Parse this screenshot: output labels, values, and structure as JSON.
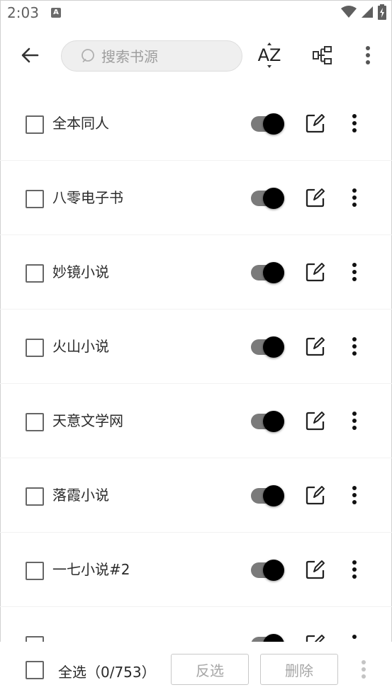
{
  "status_bar": {
    "time": "2:03",
    "notification_badge": "A"
  },
  "toolbar": {
    "back_icon": "arrow-left-icon",
    "search_placeholder": "搜索书源",
    "sort_label": "AZ",
    "group_icon": "group-tree-icon",
    "more_icon": "more-vert-icon"
  },
  "sources": [
    {
      "name": "全本同人",
      "checked": false,
      "enabled": true
    },
    {
      "name": "八零电子书",
      "checked": false,
      "enabled": true
    },
    {
      "name": "妙镜小说",
      "checked": false,
      "enabled": true
    },
    {
      "name": "火山小说",
      "checked": false,
      "enabled": true
    },
    {
      "name": "天意文学网",
      "checked": false,
      "enabled": true
    },
    {
      "name": "落霞小说",
      "checked": false,
      "enabled": true
    },
    {
      "name": "一七小说#2",
      "checked": false,
      "enabled": true
    },
    {
      "name": "",
      "checked": false,
      "enabled": true
    }
  ],
  "bottom_bar": {
    "select_all_label": "全选（0/753）",
    "invert_label": "反选",
    "delete_label": "删除"
  },
  "colors": {
    "switch_track": "#7a7a7a",
    "switch_thumb": "#000000",
    "search_bg": "#efefef",
    "disabled_text": "#a6a6a6"
  }
}
